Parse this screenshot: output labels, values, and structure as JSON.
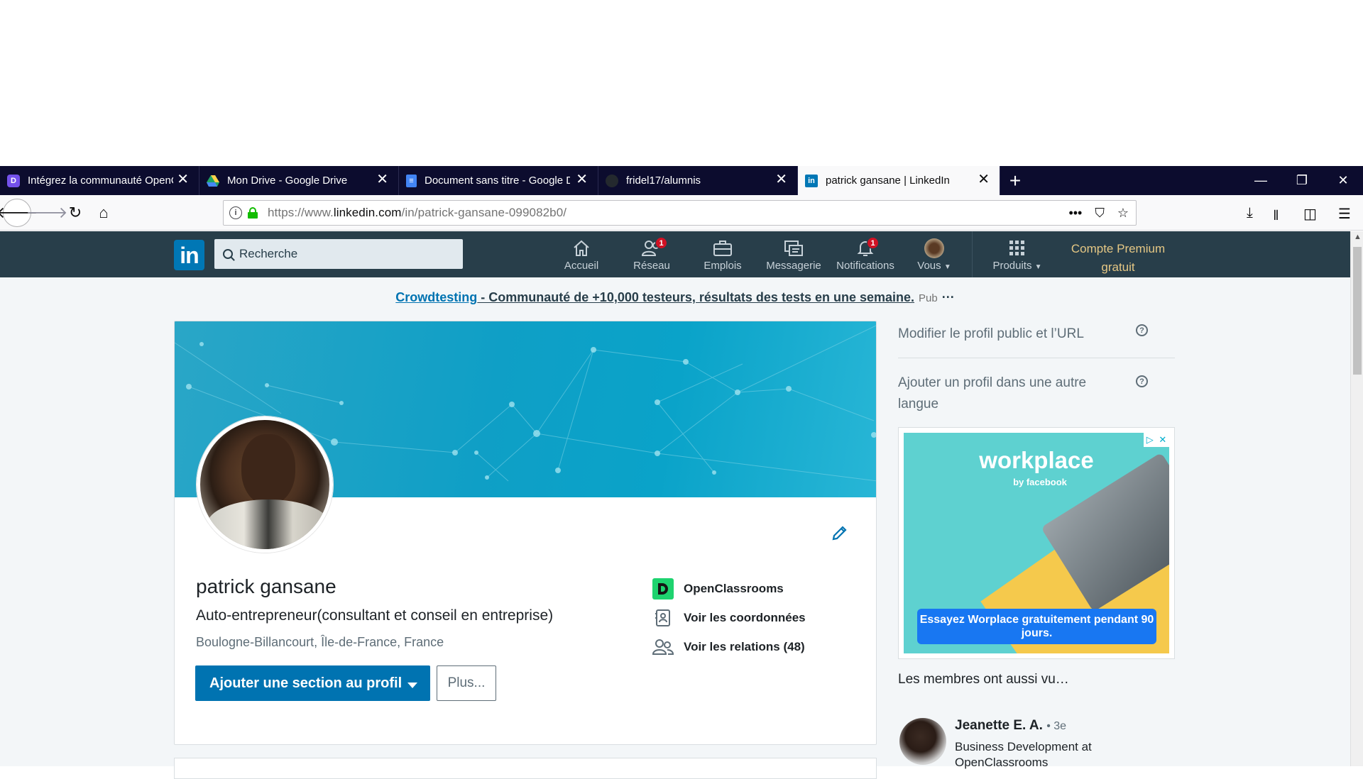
{
  "browser": {
    "tabs": [
      {
        "title": "Intégrez la communauté OpenC",
        "favicon": "openclassrooms-icon",
        "color": "#7451eb"
      },
      {
        "title": "Mon Drive - Google Drive",
        "favicon": "google-drive-icon",
        "color": "#f4b400"
      },
      {
        "title": "Document sans titre - Google D",
        "favicon": "google-docs-icon",
        "color": "#4285f4"
      },
      {
        "title": "fridel17/alumnis",
        "favicon": "github-icon",
        "color": "#24292e"
      },
      {
        "title": "patrick gansane | LinkedIn",
        "favicon": "linkedin-icon",
        "color": "#0077b5"
      }
    ],
    "url_prefix": "https://www.",
    "url_domain": "linkedin.com",
    "url_path": "/in/patrick-gansane-099082b0/"
  },
  "linkedin": {
    "logo_text": "in",
    "search_placeholder": "Recherche",
    "nav": [
      {
        "label": "Accueil",
        "icon": "home-icon",
        "badge": ""
      },
      {
        "label": "Réseau",
        "icon": "network-icon",
        "badge": "1"
      },
      {
        "label": "Emplois",
        "icon": "briefcase-icon",
        "badge": ""
      },
      {
        "label": "Messagerie",
        "icon": "messaging-icon",
        "badge": ""
      },
      {
        "label": "Notifications",
        "icon": "bell-icon",
        "badge": "1"
      },
      {
        "label": "Vous",
        "icon": "avatar",
        "badge": ""
      }
    ],
    "products_label": "Produits",
    "premium_line1": "Compte Premium",
    "premium_line2": "gratuit",
    "ad_line": {
      "cta": "Crowdtesting",
      "text": " - Communauté de +10,000 testeurs, résultats des tests en une semaine.",
      "pub": "Pub",
      "dots": "···"
    },
    "profile": {
      "name": "patrick gansane",
      "headline": "Auto-entrepreneur(consultant et conseil en entreprise)",
      "location": "Boulogne-Billancourt, Île-de-France, France",
      "add_section_label": "Ajouter une section au profil",
      "more_label": "Plus...",
      "company": "OpenClassrooms",
      "contact_label": "Voir les coordonnées",
      "connections_label": "Voir les relations (48)"
    },
    "rail": {
      "edit_public_profile": "Modifier le profil public et l’URL",
      "add_language_profile": "Ajouter un profil dans une autre langue",
      "ad": {
        "brand": "workplace",
        "by": "by facebook",
        "cta": "Essayez Worplace gratuitement pendant 90 jours."
      },
      "members_title": "Les membres ont aussi vu…",
      "member": {
        "name": "Jeanette E. A.",
        "degree": "• 3e",
        "role_line1": "Business Development at",
        "role_line2": "OpenClassrooms"
      }
    }
  }
}
